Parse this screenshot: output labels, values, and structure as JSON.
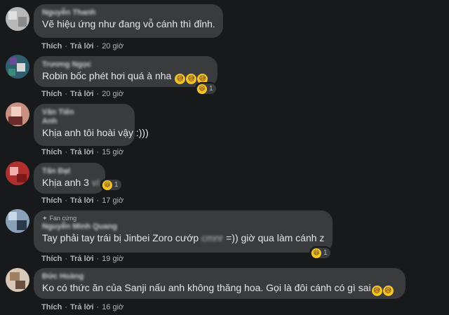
{
  "actions": {
    "like_label": "Thích",
    "reply_label": "Trả lời",
    "separator": "·"
  },
  "comments": [
    {
      "name": "Nguyễn Thanh",
      "text": "Vẽ hiệu ứng như đang vỗ cánh thì đỉnh.",
      "time": "20 giờ",
      "avatar_colors": [
        "#c8c8c8",
        "#9a9a9a",
        "#e0e0e0",
        "#7e7e7e"
      ]
    },
    {
      "name": "Trương Ngọc",
      "text": "Robin bốc phét hơi quá à nha",
      "emoji": [
        "grinning-sweat-emoji",
        "grinning-sweat-emoji",
        "grinning-sweat-emoji"
      ],
      "reaction": {
        "icon": "haha-reaction-icon",
        "count": "1"
      },
      "time": "20 giờ",
      "avatar_colors": [
        "#3c8a7a",
        "#6c4a9a",
        "#d8d8d8",
        "#2a4a6a"
      ]
    },
    {
      "name": "Văn Tiến",
      "name_line2": "Anh",
      "text": "Khịa anh tôi hoài vậy :)))",
      "time": "15 giờ",
      "avatar_colors": [
        "#d89a8a",
        "#b04a3a",
        "#f0d0c0",
        "#6a2a2a"
      ]
    },
    {
      "name": "Tấn Đạt",
      "text": "Khịa anh 3",
      "text_hidden": "ví",
      "reaction": {
        "icon": "haha-reaction-icon",
        "count": "1"
      },
      "time": "17 giờ",
      "avatar_colors": [
        "#c03030",
        "#e07070",
        "#7a1a1a",
        "#f0b0b0"
      ]
    },
    {
      "badge": "Fan cứng",
      "name": "Nguyễn Minh Quang",
      "text_before": "Tay phải tay trái bị Jinbei Zoro cướp ",
      "text_hidden": "cmnr",
      "text_after": " =)) giờ qua làm cánh z",
      "reaction": {
        "icon": "haha-reaction-icon",
        "count": "1"
      },
      "time": "19 giờ",
      "avatar_colors": [
        "#4a6a8a",
        "#c8d8e8",
        "#8aa0b8",
        "#2a3a4a"
      ]
    },
    {
      "name": "Đức Hoàng",
      "text": "Ko có thức ăn của Sanji nấu anh không thăng hoa. Gọi là đôi cánh có gì sai",
      "emoji": [
        "grinning-sweat-emoji",
        "grinning-sweat-emoji"
      ],
      "time": "16 giờ",
      "avatar_colors": [
        "#e8d8c8",
        "#a08060",
        "#f4ece4",
        "#6a5040"
      ]
    }
  ]
}
